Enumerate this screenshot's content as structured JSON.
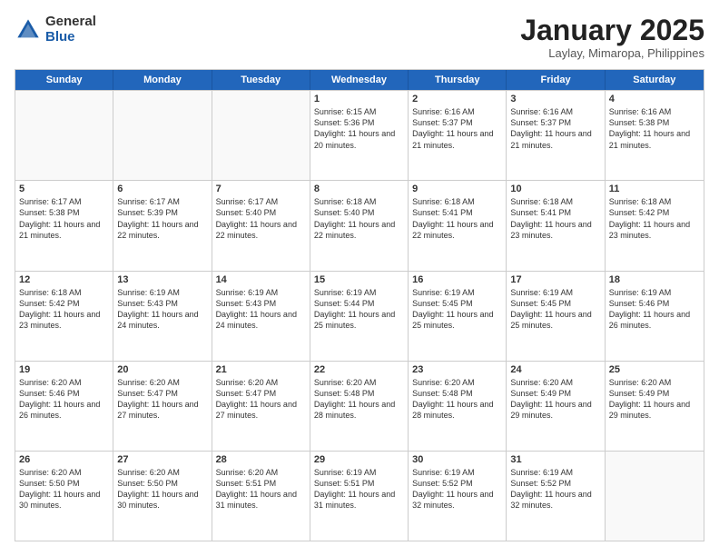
{
  "header": {
    "logo_general": "General",
    "logo_blue": "Blue",
    "month_title": "January 2025",
    "subtitle": "Laylay, Mimaropa, Philippines"
  },
  "weekdays": [
    "Sunday",
    "Monday",
    "Tuesday",
    "Wednesday",
    "Thursday",
    "Friday",
    "Saturday"
  ],
  "rows": [
    [
      {
        "day": "",
        "info": "",
        "empty": true
      },
      {
        "day": "",
        "info": "",
        "empty": true
      },
      {
        "day": "",
        "info": "",
        "empty": true
      },
      {
        "day": "1",
        "info": "Sunrise: 6:15 AM\nSunset: 5:36 PM\nDaylight: 11 hours\nand 20 minutes.",
        "empty": false
      },
      {
        "day": "2",
        "info": "Sunrise: 6:16 AM\nSunset: 5:37 PM\nDaylight: 11 hours\nand 21 minutes.",
        "empty": false
      },
      {
        "day": "3",
        "info": "Sunrise: 6:16 AM\nSunset: 5:37 PM\nDaylight: 11 hours\nand 21 minutes.",
        "empty": false
      },
      {
        "day": "4",
        "info": "Sunrise: 6:16 AM\nSunset: 5:38 PM\nDaylight: 11 hours\nand 21 minutes.",
        "empty": false
      }
    ],
    [
      {
        "day": "5",
        "info": "Sunrise: 6:17 AM\nSunset: 5:38 PM\nDaylight: 11 hours\nand 21 minutes.",
        "empty": false
      },
      {
        "day": "6",
        "info": "Sunrise: 6:17 AM\nSunset: 5:39 PM\nDaylight: 11 hours\nand 22 minutes.",
        "empty": false
      },
      {
        "day": "7",
        "info": "Sunrise: 6:17 AM\nSunset: 5:40 PM\nDaylight: 11 hours\nand 22 minutes.",
        "empty": false
      },
      {
        "day": "8",
        "info": "Sunrise: 6:18 AM\nSunset: 5:40 PM\nDaylight: 11 hours\nand 22 minutes.",
        "empty": false
      },
      {
        "day": "9",
        "info": "Sunrise: 6:18 AM\nSunset: 5:41 PM\nDaylight: 11 hours\nand 22 minutes.",
        "empty": false
      },
      {
        "day": "10",
        "info": "Sunrise: 6:18 AM\nSunset: 5:41 PM\nDaylight: 11 hours\nand 23 minutes.",
        "empty": false
      },
      {
        "day": "11",
        "info": "Sunrise: 6:18 AM\nSunset: 5:42 PM\nDaylight: 11 hours\nand 23 minutes.",
        "empty": false
      }
    ],
    [
      {
        "day": "12",
        "info": "Sunrise: 6:18 AM\nSunset: 5:42 PM\nDaylight: 11 hours\nand 23 minutes.",
        "empty": false
      },
      {
        "day": "13",
        "info": "Sunrise: 6:19 AM\nSunset: 5:43 PM\nDaylight: 11 hours\nand 24 minutes.",
        "empty": false
      },
      {
        "day": "14",
        "info": "Sunrise: 6:19 AM\nSunset: 5:43 PM\nDaylight: 11 hours\nand 24 minutes.",
        "empty": false
      },
      {
        "day": "15",
        "info": "Sunrise: 6:19 AM\nSunset: 5:44 PM\nDaylight: 11 hours\nand 25 minutes.",
        "empty": false
      },
      {
        "day": "16",
        "info": "Sunrise: 6:19 AM\nSunset: 5:45 PM\nDaylight: 11 hours\nand 25 minutes.",
        "empty": false
      },
      {
        "day": "17",
        "info": "Sunrise: 6:19 AM\nSunset: 5:45 PM\nDaylight: 11 hours\nand 25 minutes.",
        "empty": false
      },
      {
        "day": "18",
        "info": "Sunrise: 6:19 AM\nSunset: 5:46 PM\nDaylight: 11 hours\nand 26 minutes.",
        "empty": false
      }
    ],
    [
      {
        "day": "19",
        "info": "Sunrise: 6:20 AM\nSunset: 5:46 PM\nDaylight: 11 hours\nand 26 minutes.",
        "empty": false
      },
      {
        "day": "20",
        "info": "Sunrise: 6:20 AM\nSunset: 5:47 PM\nDaylight: 11 hours\nand 27 minutes.",
        "empty": false
      },
      {
        "day": "21",
        "info": "Sunrise: 6:20 AM\nSunset: 5:47 PM\nDaylight: 11 hours\nand 27 minutes.",
        "empty": false
      },
      {
        "day": "22",
        "info": "Sunrise: 6:20 AM\nSunset: 5:48 PM\nDaylight: 11 hours\nand 28 minutes.",
        "empty": false
      },
      {
        "day": "23",
        "info": "Sunrise: 6:20 AM\nSunset: 5:48 PM\nDaylight: 11 hours\nand 28 minutes.",
        "empty": false
      },
      {
        "day": "24",
        "info": "Sunrise: 6:20 AM\nSunset: 5:49 PM\nDaylight: 11 hours\nand 29 minutes.",
        "empty": false
      },
      {
        "day": "25",
        "info": "Sunrise: 6:20 AM\nSunset: 5:49 PM\nDaylight: 11 hours\nand 29 minutes.",
        "empty": false
      }
    ],
    [
      {
        "day": "26",
        "info": "Sunrise: 6:20 AM\nSunset: 5:50 PM\nDaylight: 11 hours\nand 30 minutes.",
        "empty": false
      },
      {
        "day": "27",
        "info": "Sunrise: 6:20 AM\nSunset: 5:50 PM\nDaylight: 11 hours\nand 30 minutes.",
        "empty": false
      },
      {
        "day": "28",
        "info": "Sunrise: 6:20 AM\nSunset: 5:51 PM\nDaylight: 11 hours\nand 31 minutes.",
        "empty": false
      },
      {
        "day": "29",
        "info": "Sunrise: 6:19 AM\nSunset: 5:51 PM\nDaylight: 11 hours\nand 31 minutes.",
        "empty": false
      },
      {
        "day": "30",
        "info": "Sunrise: 6:19 AM\nSunset: 5:52 PM\nDaylight: 11 hours\nand 32 minutes.",
        "empty": false
      },
      {
        "day": "31",
        "info": "Sunrise: 6:19 AM\nSunset: 5:52 PM\nDaylight: 11 hours\nand 32 minutes.",
        "empty": false
      },
      {
        "day": "",
        "info": "",
        "empty": true
      }
    ]
  ]
}
